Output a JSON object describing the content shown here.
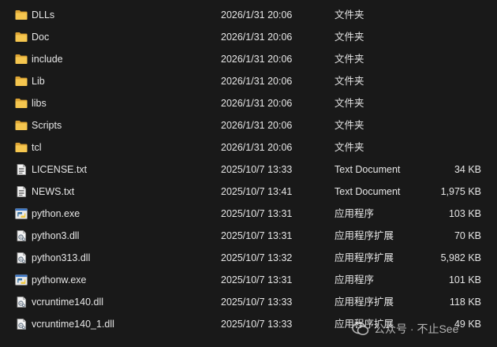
{
  "files": [
    {
      "icon": "folder-icon",
      "name": "DLLs",
      "date": "2026/1/31 20:06",
      "type": "文件夹",
      "size": ""
    },
    {
      "icon": "folder-icon",
      "name": "Doc",
      "date": "2026/1/31 20:06",
      "type": "文件夹",
      "size": ""
    },
    {
      "icon": "folder-icon",
      "name": "include",
      "date": "2026/1/31 20:06",
      "type": "文件夹",
      "size": ""
    },
    {
      "icon": "folder-icon",
      "name": "Lib",
      "date": "2026/1/31 20:06",
      "type": "文件夹",
      "size": ""
    },
    {
      "icon": "folder-icon",
      "name": "libs",
      "date": "2026/1/31 20:06",
      "type": "文件夹",
      "size": ""
    },
    {
      "icon": "folder-icon",
      "name": "Scripts",
      "date": "2026/1/31 20:06",
      "type": "文件夹",
      "size": ""
    },
    {
      "icon": "folder-icon",
      "name": "tcl",
      "date": "2026/1/31 20:06",
      "type": "文件夹",
      "size": ""
    },
    {
      "icon": "text-document-icon",
      "name": "LICENSE.txt",
      "date": "2025/10/7 13:33",
      "type": "Text Document",
      "size": "34 KB"
    },
    {
      "icon": "text-document-icon",
      "name": "NEWS.txt",
      "date": "2025/10/7 13:41",
      "type": "Text Document",
      "size": "1,975 KB"
    },
    {
      "icon": "python-exe-icon",
      "name": "python.exe",
      "date": "2025/10/7 13:31",
      "type": "应用程序",
      "size": "103 KB"
    },
    {
      "icon": "dll-file-icon",
      "name": "python3.dll",
      "date": "2025/10/7 13:31",
      "type": "应用程序扩展",
      "size": "70 KB"
    },
    {
      "icon": "dll-file-icon",
      "name": "python313.dll",
      "date": "2025/10/7 13:32",
      "type": "应用程序扩展",
      "size": "5,982 KB"
    },
    {
      "icon": "python-exe-icon",
      "name": "pythonw.exe",
      "date": "2025/10/7 13:31",
      "type": "应用程序",
      "size": "101 KB"
    },
    {
      "icon": "dll-file-icon",
      "name": "vcruntime140.dll",
      "date": "2025/10/7 13:33",
      "type": "应用程序扩展",
      "size": "118 KB"
    },
    {
      "icon": "dll-file-icon",
      "name": "vcruntime140_1.dll",
      "date": "2025/10/7 13:33",
      "type": "应用程序扩展",
      "size": "49 KB"
    }
  ],
  "watermark": {
    "icon": "wechat-official-account-icon",
    "text": "公众号 · 不止See"
  },
  "colors": {
    "background": "#191919",
    "text": "#e6e6e6",
    "folder": "#f2c14e"
  }
}
